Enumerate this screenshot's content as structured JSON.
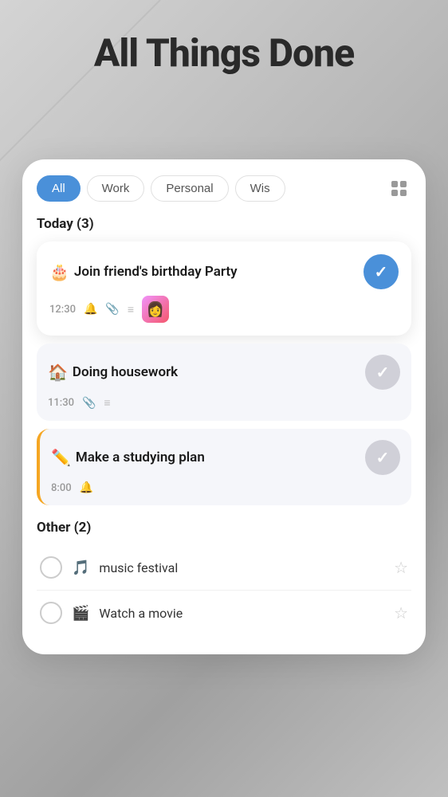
{
  "app": {
    "title": "All Things Done"
  },
  "filters": {
    "tabs": [
      {
        "label": "All",
        "active": true
      },
      {
        "label": "Work",
        "active": false
      },
      {
        "label": "Personal",
        "active": false
      },
      {
        "label": "Wis",
        "active": false
      }
    ]
  },
  "today_section": {
    "header": "Today (3)",
    "tasks": [
      {
        "id": "task-1",
        "emoji": "🎂",
        "title": "Join friend's birthday Party",
        "time": "12:30",
        "has_bell": true,
        "has_attachment": true,
        "has_list": true,
        "has_thumbnail": true,
        "thumbnail_emoji": "👩",
        "completed": true,
        "featured": true
      },
      {
        "id": "task-2",
        "emoji": "🏠",
        "title": "Doing housework",
        "time": "11:30",
        "has_bell": false,
        "has_attachment": true,
        "has_list": true,
        "has_thumbnail": false,
        "completed": true,
        "featured": false
      },
      {
        "id": "task-3",
        "emoji": "✏️",
        "title": "Make a studying plan",
        "time": "8:00",
        "has_bell": true,
        "has_attachment": false,
        "has_list": false,
        "has_thumbnail": false,
        "completed": false,
        "yellow_accent": true
      }
    ]
  },
  "other_section": {
    "header": "Other (2)",
    "tasks": [
      {
        "id": "other-1",
        "emoji": "🎵",
        "title": "music festival",
        "starred": false
      },
      {
        "id": "other-2",
        "emoji": "🎬",
        "title": "Watch a movie",
        "starred": false
      }
    ]
  }
}
